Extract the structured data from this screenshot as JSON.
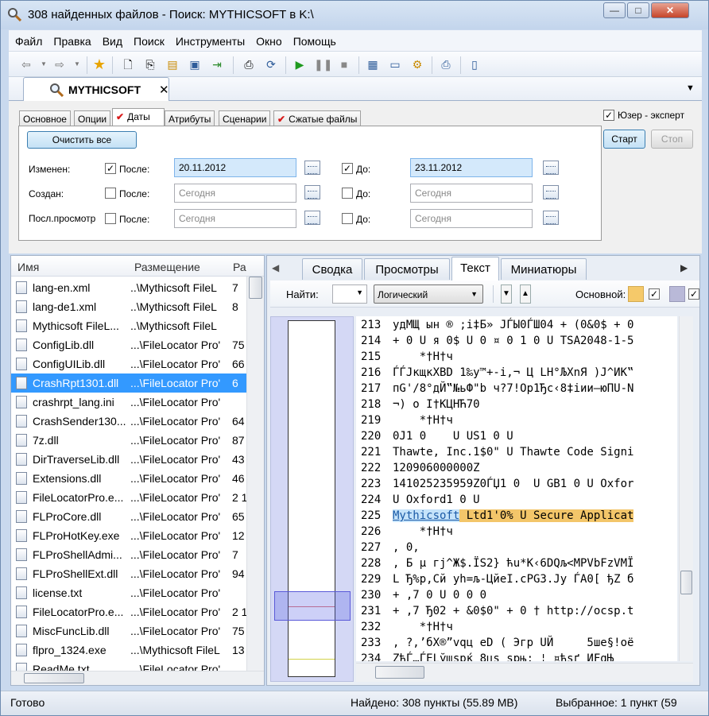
{
  "window": {
    "title": "308 найденных файлов - Поиск: MYTHICSOFT в K:\\",
    "min": "—",
    "max": "□",
    "close": "✕"
  },
  "menu": [
    "Файл",
    "Правка",
    "Вид",
    "Поиск",
    "Инструменты",
    "Окно",
    "Помощь"
  ],
  "doc_tab": {
    "label": "MYTHICSOFT",
    "close": "✕"
  },
  "criteria": {
    "tabs": [
      "Основное",
      "Опции",
      "Даты",
      "Атрибуты",
      "Сценарии",
      "Сжатые файлы"
    ],
    "clear_all": "Очистить все",
    "expert_label": "Юзер - эксперт",
    "start": "Старт",
    "stop": "Стоп",
    "rows": [
      {
        "label": "Изменен:",
        "after": "После:",
        "after_value": "20.11.2012",
        "before": "До:",
        "before_value": "23.11.2012"
      },
      {
        "label": "Создан:",
        "after": "После:",
        "after_value": "Сегодня",
        "before": "До:",
        "before_value": "Сегодня"
      },
      {
        "label": "Посл.просмотр",
        "after": "После:",
        "after_value": "Сегодня",
        "before": "До:",
        "before_value": "Сегодня"
      }
    ]
  },
  "list": {
    "columns": [
      "Имя",
      "Размещение",
      "Ра"
    ],
    "rows": [
      {
        "name": "lang-en.xml",
        "path": "..\\Mythicsoft FileL",
        "size": "7"
      },
      {
        "name": "lang-de1.xml",
        "path": "..\\Mythicsoft FileL",
        "size": "8"
      },
      {
        "name": "Mythicsoft FileL...",
        "path": "..\\Mythicsoft FileL",
        "size": ""
      },
      {
        "name": "ConfigLib.dll",
        "path": "...\\FileLocator Pro'",
        "size": "75"
      },
      {
        "name": "ConfigUILib.dll",
        "path": "...\\FileLocator Pro'",
        "size": "66"
      },
      {
        "name": "CrashRpt1301.dll",
        "path": "...\\FileLocator Pro'",
        "size": "6"
      },
      {
        "name": "crashrpt_lang.ini",
        "path": "...\\FileLocator Pro'",
        "size": ""
      },
      {
        "name": "CrashSender130...",
        "path": "...\\FileLocator Pro'",
        "size": "64"
      },
      {
        "name": "7z.dll",
        "path": "...\\FileLocator Pro'",
        "size": "87"
      },
      {
        "name": "DirTraverseLib.dll",
        "path": "...\\FileLocator Pro'",
        "size": "43"
      },
      {
        "name": "Extensions.dll",
        "path": "...\\FileLocator Pro'",
        "size": "46"
      },
      {
        "name": "FileLocatorPro.e...",
        "path": "...\\FileLocator Pro'",
        "size": "2 17"
      },
      {
        "name": "FLProCore.dll",
        "path": "...\\FileLocator Pro'",
        "size": "65"
      },
      {
        "name": "FLProHotKey.exe",
        "path": "...\\FileLocator Pro'",
        "size": "12"
      },
      {
        "name": "FLProShellAdmi...",
        "path": "...\\FileLocator Pro'",
        "size": "7"
      },
      {
        "name": "FLProShellExt.dll",
        "path": "...\\FileLocator Pro'",
        "size": "94"
      },
      {
        "name": "license.txt",
        "path": "...\\FileLocator Pro'",
        "size": ""
      },
      {
        "name": "FileLocatorPro.e...",
        "path": "...\\FileLocator Pro'",
        "size": "2 17"
      },
      {
        "name": "MiscFuncLib.dll",
        "path": "...\\FileLocator Pro'",
        "size": "75"
      },
      {
        "name": "flpro_1324.exe",
        "path": "...\\Mythicsoft FileL",
        "size": "13"
      },
      {
        "name": "ReadMe.txt",
        "path": "...\\FileLocator Pro'",
        "size": ""
      }
    ]
  },
  "preview": {
    "tabs": [
      "Сводка",
      "Просмотры",
      "Текст",
      "Миниатюры"
    ],
    "find_label": "Найти:",
    "mode": "Логический",
    "main_label": "Основной:",
    "lines": [
      {
        "n": "213",
        "t": "удМЩ ын ® ;і‡Б» JЃЫ0ЃШ04 + (0&0$ + 0"
      },
      {
        "n": "214",
        "t": "+ 0 U я 0$ U 0 ¤ 0 1 0 U TSA2048-1-5"
      },
      {
        "n": "215",
        "t": "    *†H†ч"
      },
      {
        "n": "216",
        "t": "ЃЃJкщкXBD 1‰у™+-і,¬ Ц LH°ЉХnЯ )J^ИК‟"
      },
      {
        "n": "217",
        "t": "пG'/8°дЙ‟№ьФ\"b ч?7!Op1Ђс‹8‡іии—юПU-N"
      },
      {
        "n": "218",
        "t": "¬) o I†КЦНЋ70"
      },
      {
        "n": "219",
        "t": "    *†H†ч"
      },
      {
        "n": "220",
        "t": "0J1 0    U US1 0 U"
      },
      {
        "n": "221",
        "t": "Thawte, Inc.1$0\" U Thawte Code Signi"
      },
      {
        "n": "222",
        "t": "120906000000Z"
      },
      {
        "n": "223",
        "t": "141025235959Z0ЃЏ1 0  U GB1 0 U Oxfor"
      },
      {
        "n": "224",
        "t": "U Oxford1 0 U"
      },
      {
        "n": "225",
        "t": "",
        "hl1": "Mythicsoft",
        "hl2": " Ltd1'0% U Secure Applicat"
      },
      {
        "n": "226",
        "t": "    *†H†ч"
      },
      {
        "n": "227",
        "t": ", 0,"
      },
      {
        "n": "228",
        "t": ", Б µ гj^Ж$.ЇS2} ћu*K‹6DQљ<MPVbFzVMЇ"
      },
      {
        "n": "229",
        "t": "L Ђ%р,Сй yh=љ-ЦйеI.cPG3.Jy ЃА0[ ђZ б"
      },
      {
        "n": "230",
        "t": "+ ,7 0 U 0 0 0"
      },
      {
        "n": "231",
        "t": "+ ,7 Ђ02 + &0$0\" + 0 † http://ocsp.t"
      },
      {
        "n": "232",
        "t": "    *†H†ч"
      },
      {
        "n": "233",
        "t": ", ?,’бХ®”vqц eD ( Эгр UЙ     5шe§!oё"
      },
      {
        "n": "234",
        "t": "ZђЃ…ЃELўщspќ 8цs spњ: ¦ ¤ћsґ ИFgЊ"
      }
    ]
  },
  "status": {
    "ready": "Готово",
    "found": "Найдено: 308 пункты (55.89 MB)",
    "selected": "Выбранное: 1 пункт (59"
  }
}
